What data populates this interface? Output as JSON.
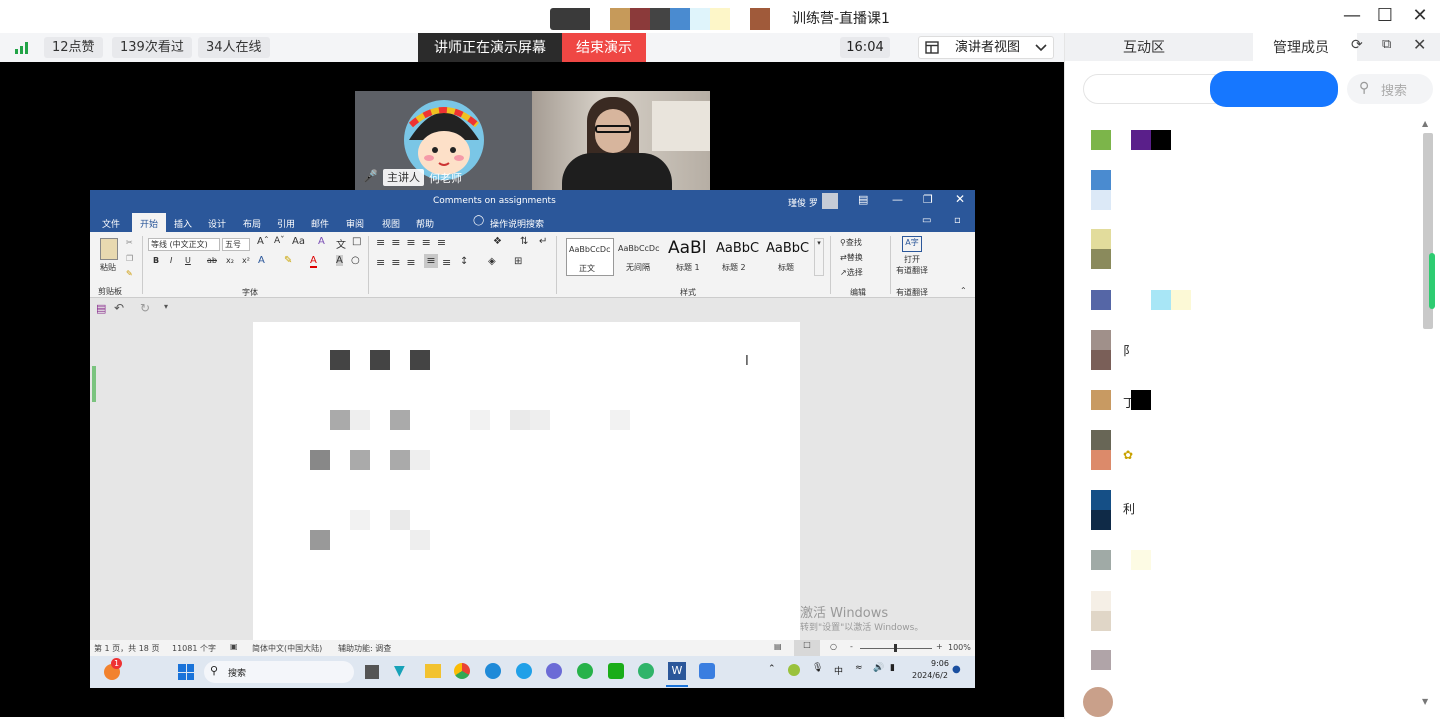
{
  "window": {
    "title": "训练营-直播课1",
    "controls": [
      "minimize-icon",
      "maximize-icon",
      "close-icon"
    ]
  },
  "status": {
    "likes": "12点赞",
    "views": "139次看过",
    "online": "34人在线",
    "presenting_label": "讲师正在演示屏幕",
    "end_button": "结束演示",
    "clock": "16:04",
    "view_mode": "演讲者视图"
  },
  "video": {
    "presenter_badge": "主讲人",
    "presenter_name": "何老师"
  },
  "word": {
    "doc_title": "Comments on assignments",
    "user_name": "瑾俊 罗",
    "tabs": [
      "文件",
      "开始",
      "插入",
      "设计",
      "布局",
      "引用",
      "邮件",
      "审阅",
      "视图",
      "帮助"
    ],
    "tell_me": "操作说明搜索",
    "ribbon": {
      "paste": "粘贴",
      "clipboard": "剪贴板",
      "font_name": "等线 (中文正文)",
      "font_size": "五号",
      "font_group": "字体",
      "styles": [
        {
          "preview": "AaBbCcDc",
          "name": "正文"
        },
        {
          "preview": "AaBbCcDc",
          "name": "无间隔"
        },
        {
          "preview": "AaBl",
          "name": "标题 1"
        },
        {
          "preview": "AaBbC",
          "name": "标题 2"
        },
        {
          "preview": "AaBbC",
          "name": "标题"
        }
      ],
      "styles_group": "样式",
      "find": "查找",
      "replace": "替换",
      "select": "选择",
      "edit_group": "编辑",
      "translate_open": "打开",
      "translate_label": "有道翻译",
      "translate_group": "有道翻译"
    },
    "statusbar": {
      "page": "第 1 页，共 18 页",
      "words": "11081 个字",
      "language": "简体中文(中国大陆)",
      "accessibility": "辅助功能: 调查",
      "zoom": "100%"
    },
    "activation": {
      "title": "激活 Windows",
      "subtitle": "转到\"设置\"以激活 Windows。"
    },
    "taskbar": {
      "search": "搜索",
      "ime": "中",
      "time": "9:06",
      "date": "2024/6/2",
      "badge": "1"
    }
  },
  "panel": {
    "tabs": [
      "互动区",
      "管理成员"
    ],
    "search_placeholder": "搜索",
    "members_visible_text": [
      "阝",
      "丁",
      "利"
    ]
  }
}
